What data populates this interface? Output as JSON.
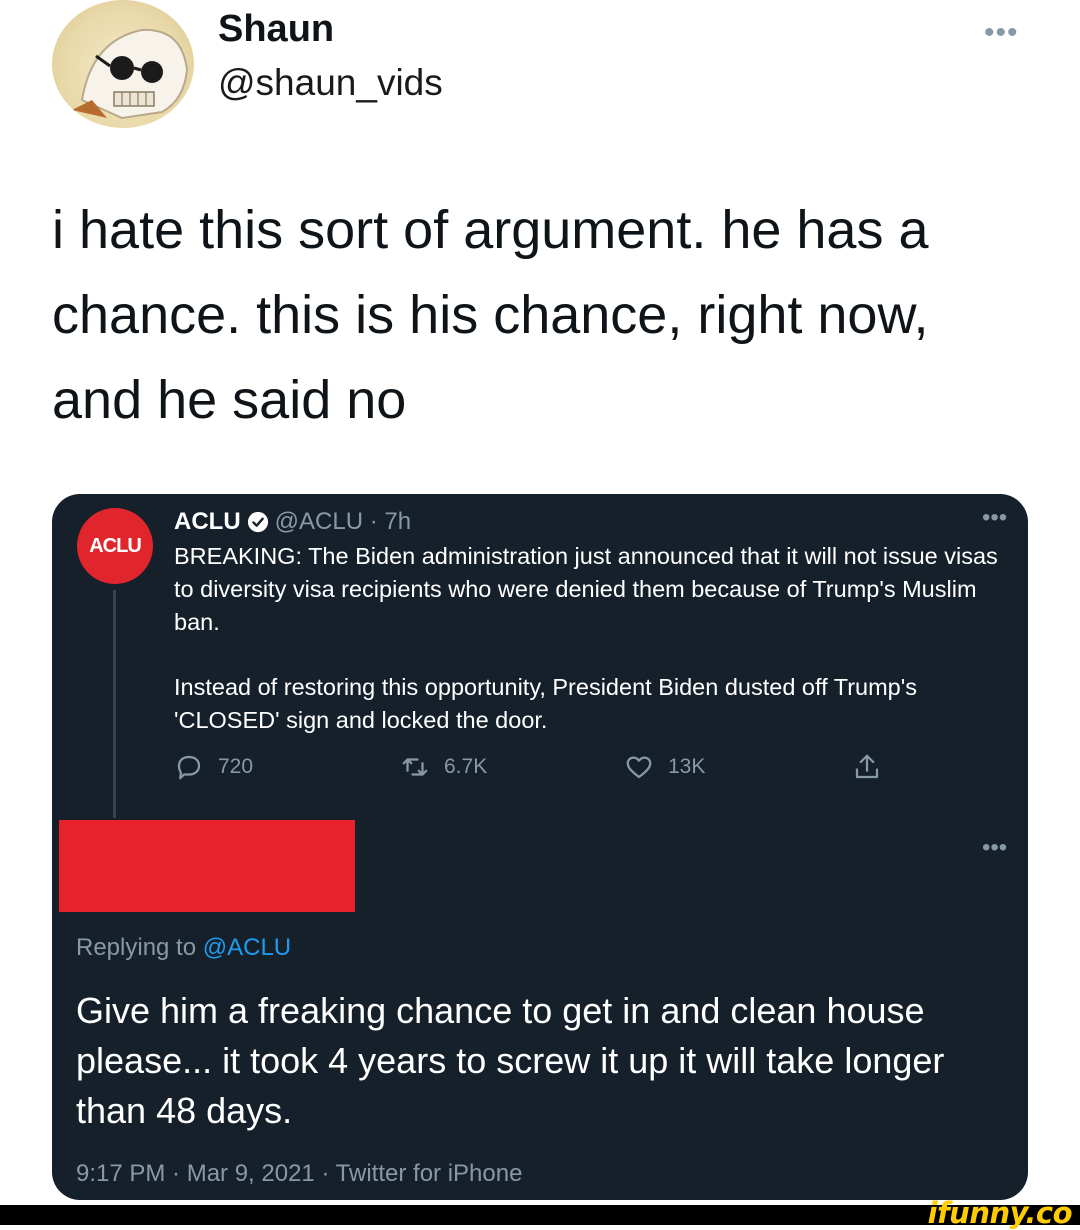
{
  "author": {
    "name": "Shaun",
    "handle": "@shaun_vids",
    "more_label": "•••"
  },
  "tweet": {
    "text": "i hate this sort of argument. he has a chance. this is his chance, right now, and he said no"
  },
  "quoted": {
    "avatar_text": "ACLU",
    "name": "ACLU",
    "handle_time": "@ACLU · 7h",
    "more_label": "•••",
    "paragraph1": "BREAKING: The Biden administration just announced that it will not issue visas to diversity visa recipients who were denied them because of Trump's Muslim ban.",
    "paragraph2": "Instead of restoring this opportunity, President Biden dusted off Trump's 'CLOSED' sign and locked the door.",
    "actions": {
      "replies": "720",
      "retweets": "6.7K",
      "likes": "13K"
    }
  },
  "reply": {
    "more_label": "•••",
    "replying_prefix": "Replying to ",
    "replying_mention": "@ACLU",
    "text": "Give him a freaking chance to get in and clean house please... it took 4 years to screw it up it will take longer than 48 days.",
    "meta": "9:17 PM · Mar 9, 2021 · Twitter for iPhone"
  },
  "watermark": "ifunny.co",
  "colors": {
    "card_bg": "#15202b",
    "accent": "#1d9bf0",
    "muted": "#8899a6",
    "aclu_red": "#e0252c",
    "redaction": "#e8222a",
    "watermark": "#ffcc00"
  },
  "icons": [
    "more-icon",
    "verified-icon",
    "reply-icon",
    "retweet-icon",
    "like-icon",
    "share-icon"
  ]
}
